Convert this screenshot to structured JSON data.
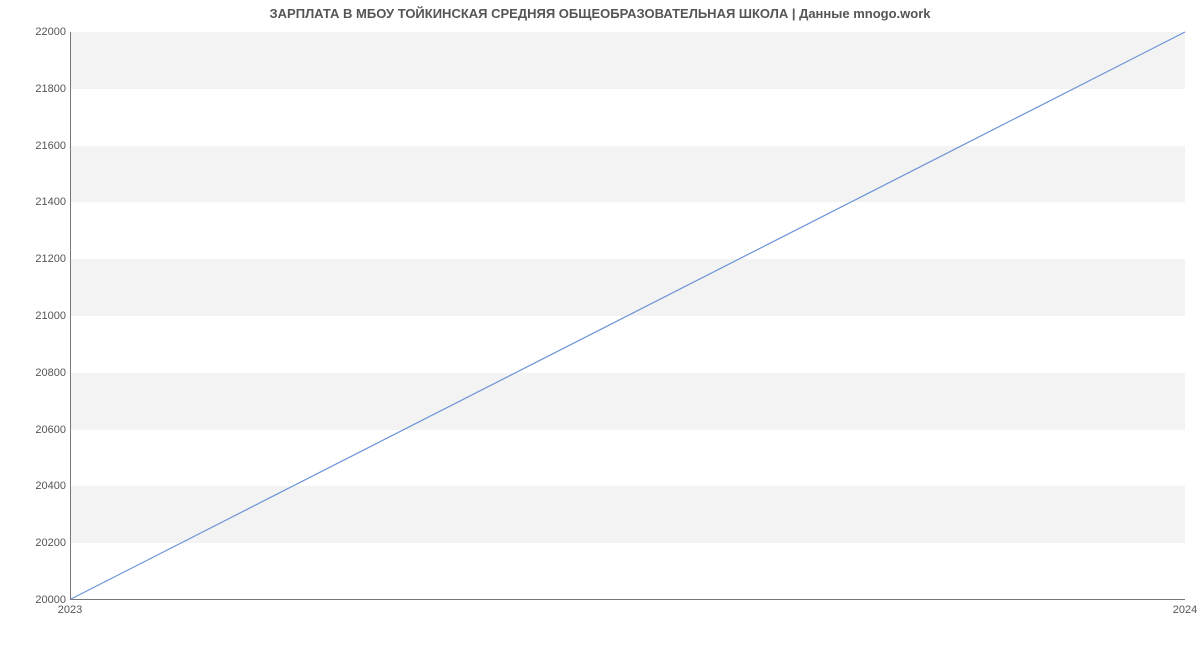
{
  "chart_data": {
    "type": "line",
    "title": "ЗАРПЛАТА В МБОУ ТОЙКИНСКАЯ СРЕДНЯЯ  ОБЩЕОБРАЗОВАТЕЛЬНАЯ ШКОЛА | Данные mnogo.work",
    "x": [
      "2023",
      "2024"
    ],
    "values": [
      20000,
      22000
    ],
    "xlabel": "",
    "ylabel": "",
    "ylim": [
      20000,
      22000
    ],
    "yticks": [
      20000,
      20200,
      20400,
      20600,
      20800,
      21000,
      21200,
      21400,
      21600,
      21800,
      22000
    ],
    "xticks": [
      "2023",
      "2024"
    ],
    "line_color": "#6b94d6",
    "grid_bands": true
  }
}
